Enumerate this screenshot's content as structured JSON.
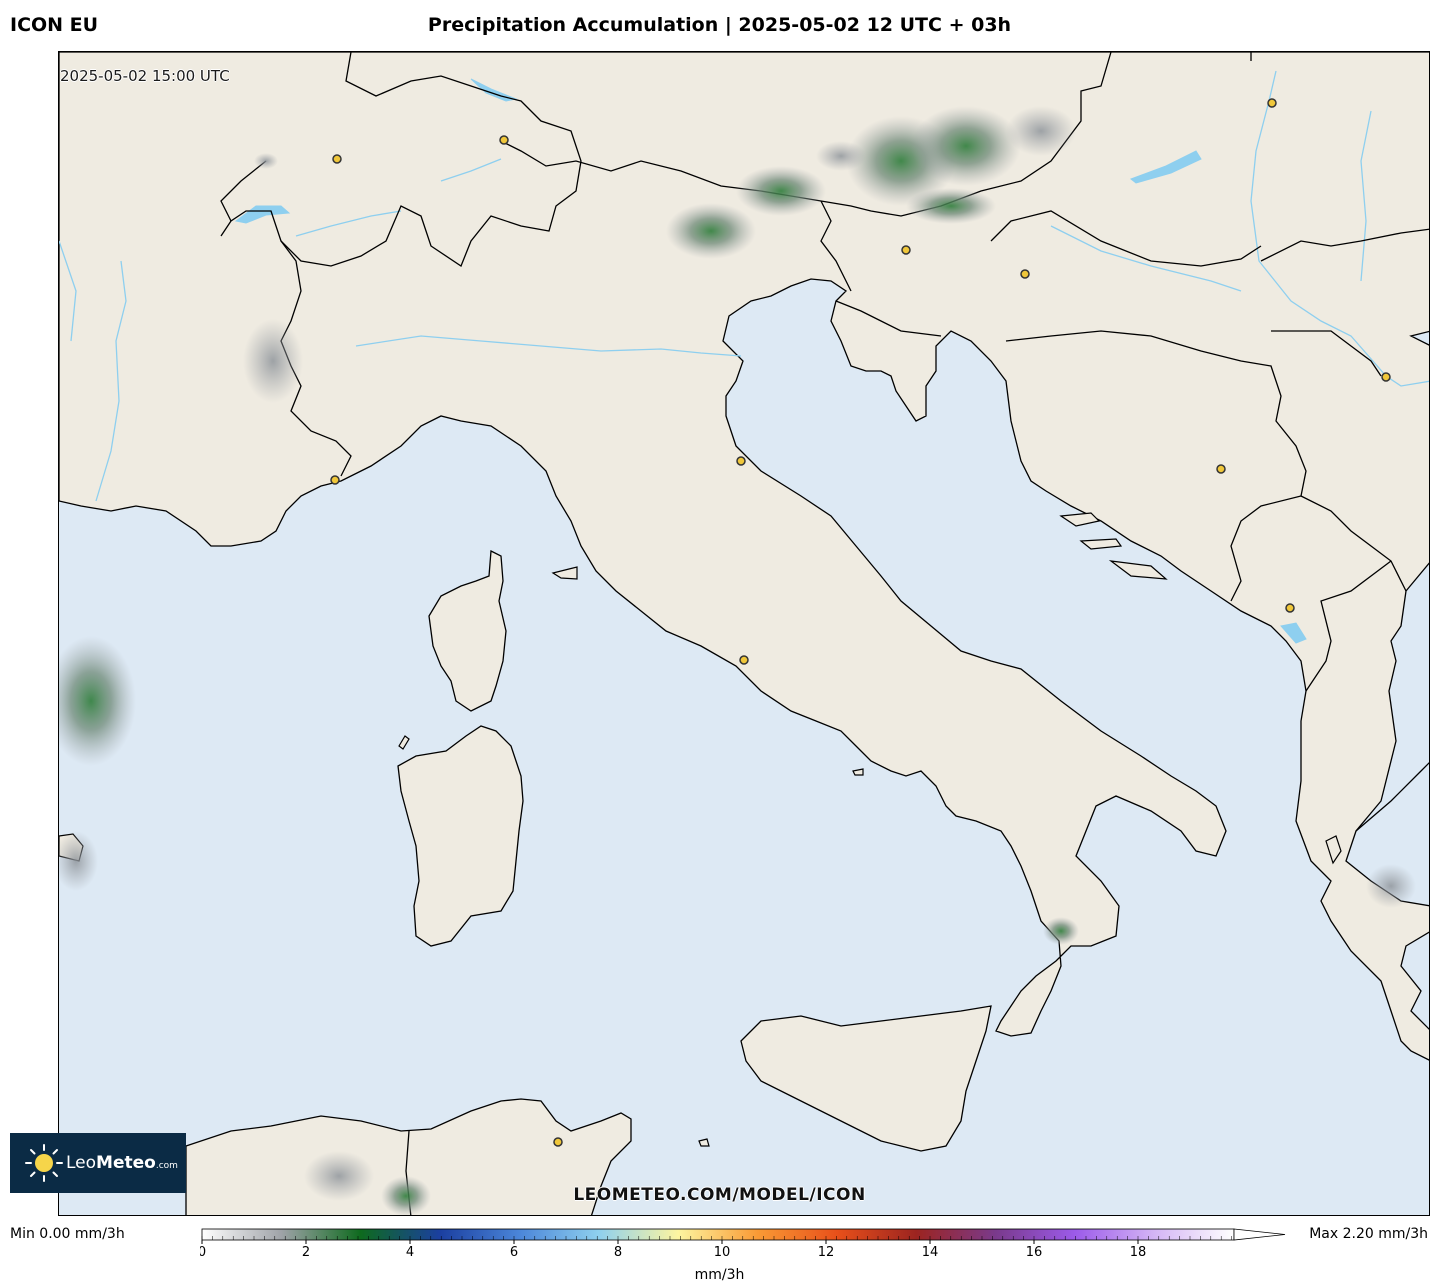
{
  "header": {
    "model": "ICON EU",
    "title": "Precipitation Accumulation | 2025-05-02 12 UTC + 03h"
  },
  "map": {
    "valid_time": "2025-05-02 15:00 UTC",
    "watermark": "LEOMETEO.COM/MODEL/ICON",
    "colors": {
      "sea": "#dde9f4",
      "land": "#efebe1",
      "border": "#000000",
      "river": "#8ecfef",
      "city": "#f0c73a"
    }
  },
  "logo": {
    "brand_light": "Leo",
    "brand_bold": "Meteo",
    "brand_suffix": ".com"
  },
  "colorbar": {
    "min_label": "Min 0.00 mm/3h",
    "max_label": "Max 2.20 mm/3h",
    "unit": "mm/3h",
    "ticks": [
      "0",
      "2",
      "4",
      "6",
      "8",
      "10",
      "12",
      "14",
      "16",
      "18"
    ],
    "vmin": 0,
    "vmax": 20,
    "stops": [
      "#ffffff",
      "#9fa3a8",
      "#0e6a1e",
      "#1b3fa0",
      "#4b86d9",
      "#8fd0ee",
      "#fdf5a0",
      "#f99a35",
      "#e8501a",
      "#9c2420",
      "#7a3a8c",
      "#9c5bea",
      "#d4b5f5",
      "#ffffff"
    ]
  }
}
